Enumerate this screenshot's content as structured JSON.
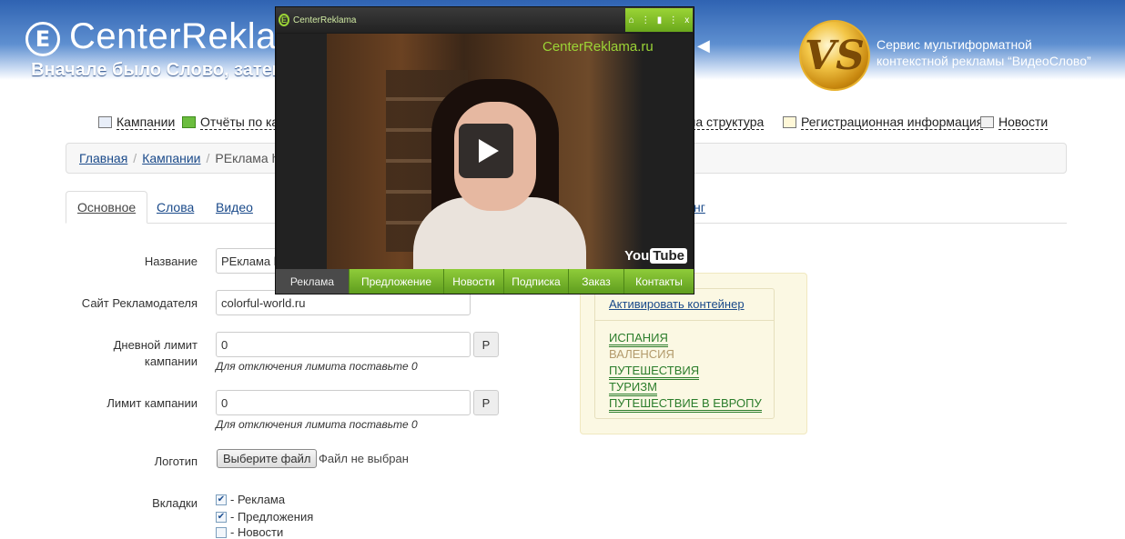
{
  "header": {
    "logo_letter": "E",
    "logo_text": "CenterReklama",
    "slogan": "Вначале было Слово, затем Видео",
    "service_text_line1": "Сервис мультиформатной",
    "service_text_line2": "контекстной рекламы “ВидеоСлово”",
    "vs_letters": "VS"
  },
  "topnav": {
    "items": [
      {
        "label": "Кампании",
        "icon": "monitor-icon"
      },
      {
        "label": "Отчёты по кампаниям",
        "icon": "chart-icon"
      },
      {
        "label": "Ваша структура",
        "icon": "structure-icon"
      },
      {
        "label": "Регистрационная информация",
        "icon": "edit-icon"
      },
      {
        "label": "Новости",
        "icon": "news-icon"
      }
    ]
  },
  "breadcrumb": {
    "home": "Главная",
    "campaigns": "Кампании",
    "current": "РЕклама http"
  },
  "tabs": {
    "items": [
      "Основное",
      "Слова",
      "Видео",
      "нг"
    ]
  },
  "form": {
    "name_label": "Название",
    "name_value": "РЕклама h",
    "site_label": "Сайт Рекламодателя",
    "site_value": "colorful-world.ru",
    "daily_limit_label": "Дневной лимит кампании",
    "daily_limit_value": "0",
    "currency": "Р",
    "limit_hint": "Для отключения лимита поставьте 0",
    "campaign_limit_label": "Лимит кампании",
    "campaign_limit_value": "0",
    "logo_label": "Логотип",
    "file_button": "Выберите файл",
    "file_status": "Файл не выбран",
    "tabs_label": "Вкладки",
    "checkboxes": [
      {
        "label": "- Реклама",
        "checked": true
      },
      {
        "label": "- Предложения",
        "checked": true
      },
      {
        "label": "- Новости",
        "checked": false
      }
    ]
  },
  "keywords": {
    "activate_link": "Активировать контейнер",
    "items": [
      {
        "label": "ИСПАНИЯ",
        "muted": false
      },
      {
        "label": "ВАЛЕНСИЯ",
        "muted": true
      },
      {
        "label": "ПУТЕШЕСТВИЯ",
        "muted": false
      },
      {
        "label": "ТУРИЗМ",
        "muted": false
      },
      {
        "label": "ПУТЕШЕСТВИЕ В ЕВРОПУ",
        "muted": false
      }
    ]
  },
  "player": {
    "title": "CenterReklama",
    "logo_letter": "E",
    "watermark": "CenterReklama.ru",
    "youtube_you": "You",
    "youtube_tube": "Tube",
    "controls": [
      "⌂",
      "⋮",
      "▮",
      "⋮",
      "x"
    ],
    "menu": [
      "Реклама",
      "Предложение",
      "Новости",
      "Подписка",
      "Заказ",
      "Контакты"
    ],
    "active_menu": "Реклама"
  },
  "colors": {
    "header_blue": "#2f63b2",
    "player_green": "#8fcc3a",
    "keyword_green": "#2b7d2b",
    "panel_bg": "#fbf8e3"
  }
}
